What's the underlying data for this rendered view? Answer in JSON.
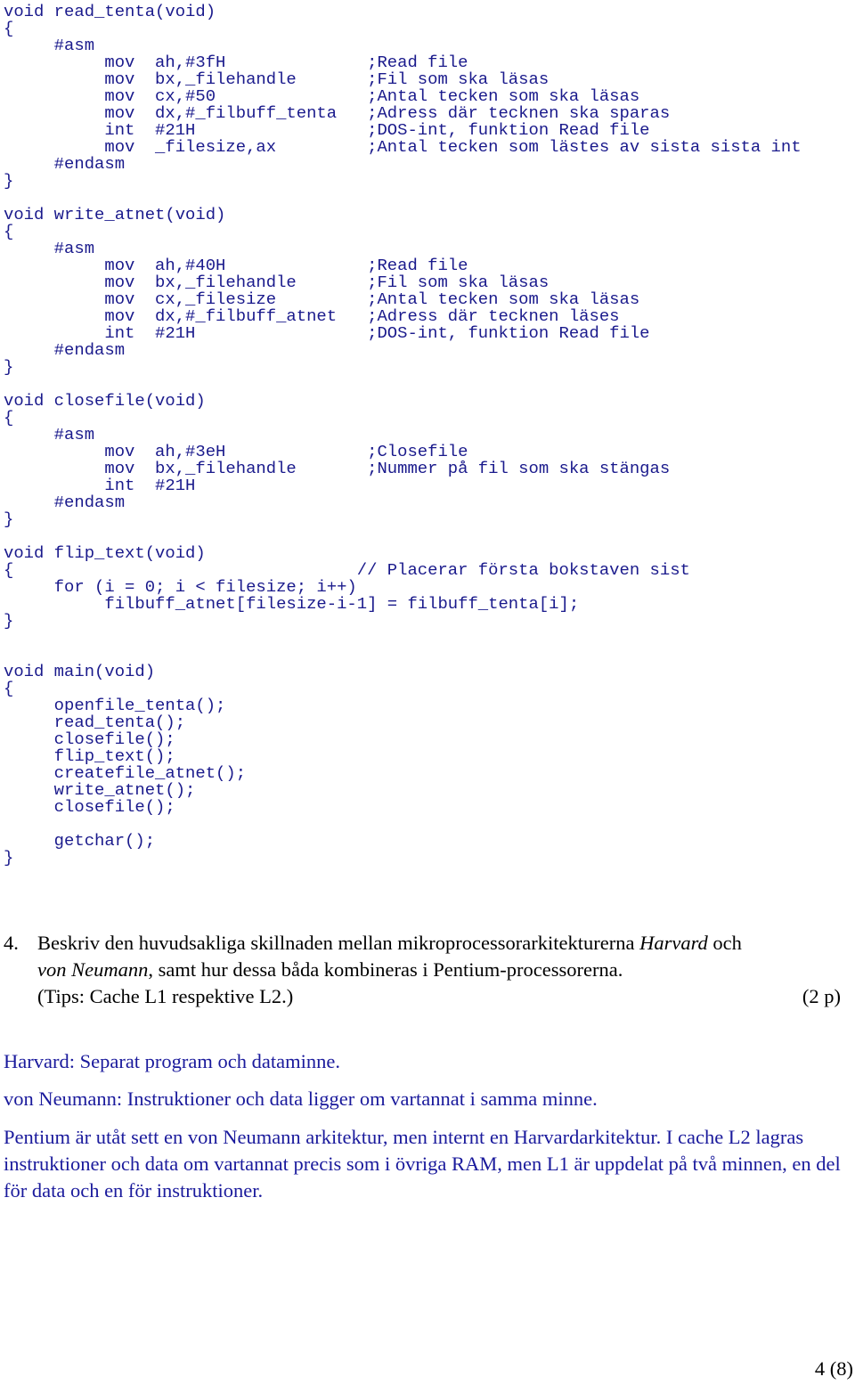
{
  "code": {
    "lines": [
      "void read_tenta(void)",
      "{",
      "     #asm",
      "          mov  ah,#3fH              ;Read file",
      "          mov  bx,_filehandle       ;Fil som ska läsas",
      "          mov  cx,#50               ;Antal tecken som ska läsas",
      "          mov  dx,#_filbuff_tenta   ;Adress där tecknen ska sparas",
      "          int  #21H                 ;DOS-int, funktion Read file",
      "          mov  _filesize,ax         ;Antal tecken som lästes av sista sista int",
      "     #endasm",
      "}",
      "",
      "void write_atnet(void)",
      "{",
      "     #asm",
      "          mov  ah,#40H              ;Read file",
      "          mov  bx,_filehandle       ;Fil som ska läsas",
      "          mov  cx,_filesize         ;Antal tecken som ska läsas",
      "          mov  dx,#_filbuff_atnet   ;Adress där tecknen läses",
      "          int  #21H                 ;DOS-int, funktion Read file",
      "     #endasm",
      "}",
      "",
      "void closefile(void)",
      "{",
      "     #asm",
      "          mov  ah,#3eH              ;Closefile",
      "          mov  bx,_filehandle       ;Nummer på fil som ska stängas",
      "          int  #21H",
      "     #endasm",
      "}",
      "",
      "void flip_text(void)",
      "{                                  // Placerar första bokstaven sist",
      "     for (i = 0; i < filesize; i++)",
      "          filbuff_atnet[filesize-i-1] = filbuff_tenta[i];",
      "}",
      "",
      "",
      "void main(void)",
      "{",
      "     openfile_tenta();",
      "     read_tenta();",
      "     closefile();",
      "     flip_text();",
      "     createfile_atnet();",
      "     write_atnet();",
      "     closefile();",
      "",
      "     getchar();",
      "}"
    ]
  },
  "question": {
    "number": "4.",
    "part1": "Beskriv den huvudsakliga skillnaden mellan mikroprocessorarkitekturerna ",
    "harvard_italic": "Harvard",
    "part2": " och",
    "vonneumann_italic": "von Neumann",
    "part3": ", samt hur dessa båda kombineras i Pentium-processorerna.",
    "tips": "(Tips: Cache L1 respektive L2.)",
    "points": "(2 p)"
  },
  "answer": {
    "harvard": "Harvard: Separat program och dataminne.",
    "vonneumann": "von Neumann: Instruktioner och data ligger om vartannat i samma minne.",
    "pentium": "Pentium är utåt sett en von Neumann arkitektur, men internt en Harvardarkitektur. I cache L2 lagras instruktioner och data om vartannat precis som i övriga RAM, men L1 är uppdelat på två minnen, en del för data och en för instruktioner."
  },
  "footer": {
    "page_number": "4 (8)"
  }
}
